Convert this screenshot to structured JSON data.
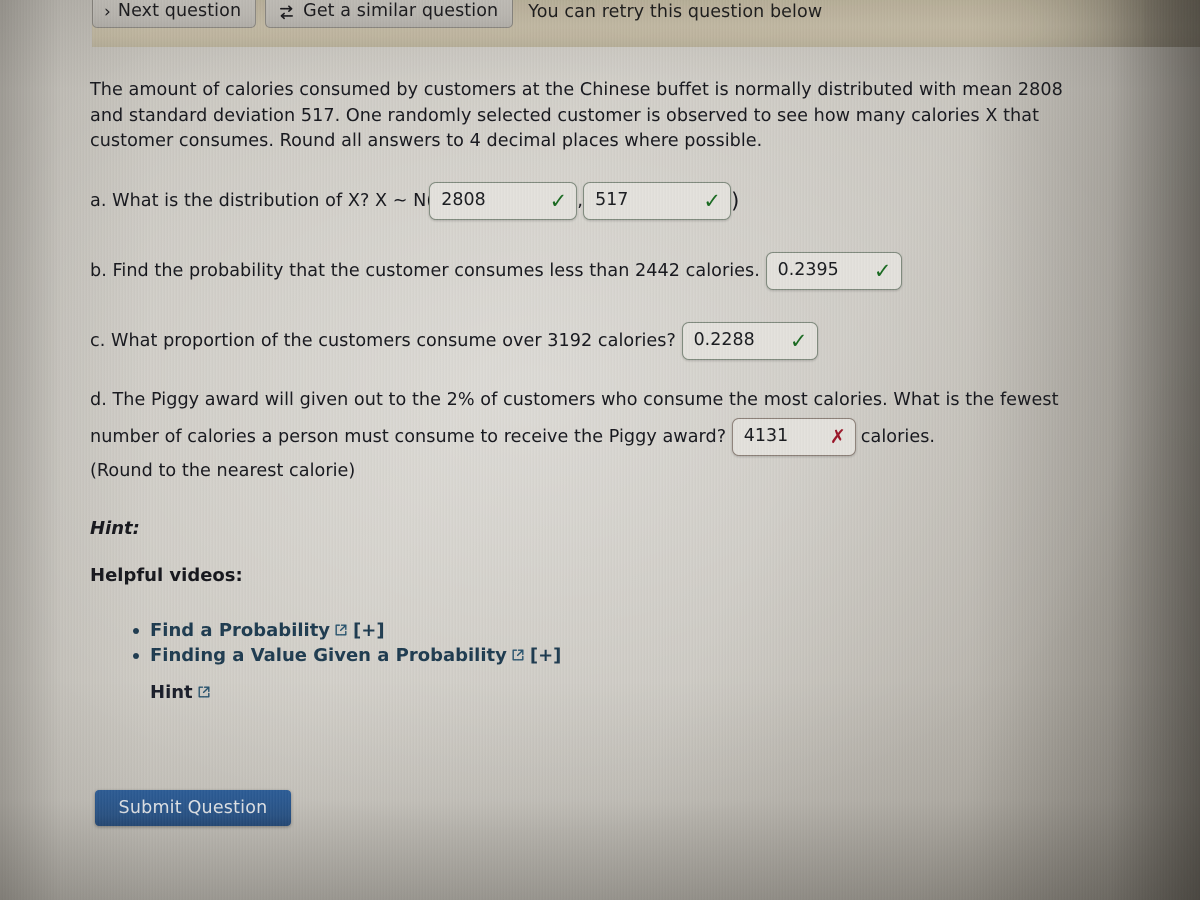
{
  "toolbar": {
    "next_question_label": "Next question",
    "next_icon": "chevron-right-icon",
    "similar_question_label": "Get a similar question",
    "similar_icon": "cycle-refresh-icon",
    "retry_note": "You can retry this question below"
  },
  "question": {
    "prompt": "The amount of calories consumed by customers at the Chinese buffet is normally distributed with mean 2808 and standard deviation 517. One randomly selected customer is observed to see how many calories X that customer consumes. Round all answers to 4 decimal places where possible.",
    "parts": {
      "a": {
        "text": "a. What is the distribution of X? X ~ N(",
        "mean_value": "2808",
        "mean_status": "correct",
        "sd_value": "517",
        "sd_status": "correct",
        "close_paren": ")",
        "separator": ","
      },
      "b": {
        "text": "b. Find the probability that the customer consumes less than 2442 calories.",
        "value": "0.2395",
        "status": "correct"
      },
      "c": {
        "text": "c. What proportion of the customers consume over 3192 calories?",
        "value": "0.2288",
        "status": "correct"
      },
      "d": {
        "text_before": "d. The Piggy award will given out to the 2% of customers who consume the most calories. What is the fewest number of calories a person must consume to receive the Piggy award?",
        "value": "4131",
        "status": "incorrect",
        "unit": "calories.",
        "rounding_note": "(Round to the nearest calorie)"
      }
    }
  },
  "hint": {
    "hint_label": "Hint:",
    "videos_label": "Helpful videos:",
    "videos": [
      {
        "label": "Find a Probability",
        "icon": "external-link-icon",
        "expand": "[+]"
      },
      {
        "label": "Finding a Value Given a Probability",
        "icon": "external-link-icon",
        "expand": "[+]"
      }
    ],
    "hint_link": {
      "label": "Hint",
      "icon": "external-link-icon"
    }
  },
  "submit": {
    "label": "Submit Question"
  },
  "colors": {
    "correct_check": "#17691f",
    "incorrect_cross": "#9a1427",
    "submit_blue": "#2b5f9e",
    "link_navy": "#1d3a4f",
    "toolbar_band": "#d0c7ae"
  }
}
